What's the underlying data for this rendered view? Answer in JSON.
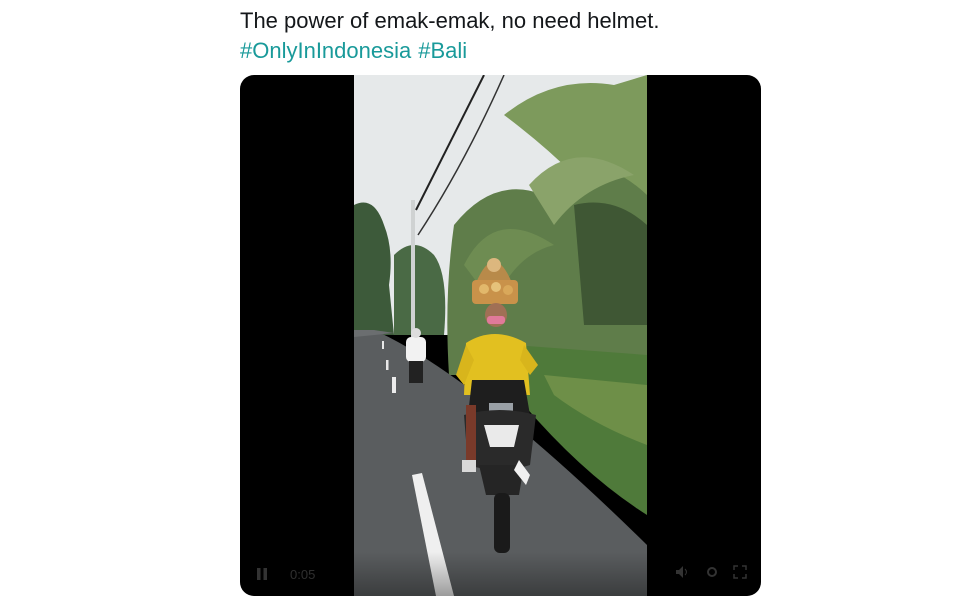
{
  "tweet": {
    "text": "The power of emak-emak,  no need helmet.",
    "hashtags": [
      "#OnlyInIndonesia",
      "#Bali"
    ]
  },
  "video": {
    "controls": {
      "play_icon": "pause-icon",
      "time": "0:05",
      "volume_icon": "volume-icon",
      "settings_icon": "gear-icon",
      "fullscreen_icon": "fullscreen-icon"
    }
  },
  "colors": {
    "text": "#14171a",
    "hashtag": "#199a9a",
    "video_bg": "#000000"
  }
}
